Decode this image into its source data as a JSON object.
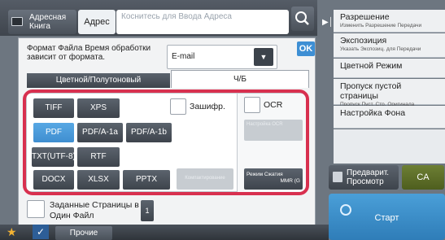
{
  "header": {
    "addr_book_label": "Адресная Книга",
    "addr_label": "Адрес",
    "addr_placeholder": "Коснитесь для Ввода Адреса"
  },
  "right_menu": [
    {
      "title": "Разрешение",
      "subtitle": "Изменить Разрешение Передачи"
    },
    {
      "title": "Экспозиция",
      "subtitle": "Указать Экспозиц. для Передачи"
    },
    {
      "title": "Цветной Режим",
      "subtitle": ""
    },
    {
      "title": "Пропуск пустой страницы",
      "subtitle": "Пропуск Пуст. Стр. Оригинала"
    },
    {
      "title": "Настройка Фона",
      "subtitle": ""
    }
  ],
  "preview_label": "Предварит. Просмотр",
  "ca_label": "CA",
  "start_label": "Старт",
  "dialog": {
    "format_label": "Формат Файла Время обработки зависит от формата.",
    "format_value": "E-mail",
    "ok_label": "OK",
    "tab_color": "Цветной/Полутоновый",
    "tab_bw": "Ч/Б",
    "buttons": {
      "tiff": "TIFF",
      "xps": "XPS",
      "pdf": "PDF",
      "pdfa1a": "PDF/A-1a",
      "pdfa1b": "PDF/A-1b",
      "txt": "TXT(UTF-8)",
      "rtf": "RTF",
      "docx": "DOCX",
      "xlsx": "XLSX",
      "pptx": "PPTX"
    },
    "encrypt_label": "Зашифр.",
    "ocr_label": "OCR",
    "ocr_setting": "Настройка OCR",
    "compact_label": "Компактирование",
    "compress_label": "Режим Сжатия",
    "compress_value": "MMR (G",
    "pages_label": "Заданные Страницы в Один Файл",
    "pages_value": "1"
  },
  "footer": {
    "other_label": "Прочие"
  }
}
